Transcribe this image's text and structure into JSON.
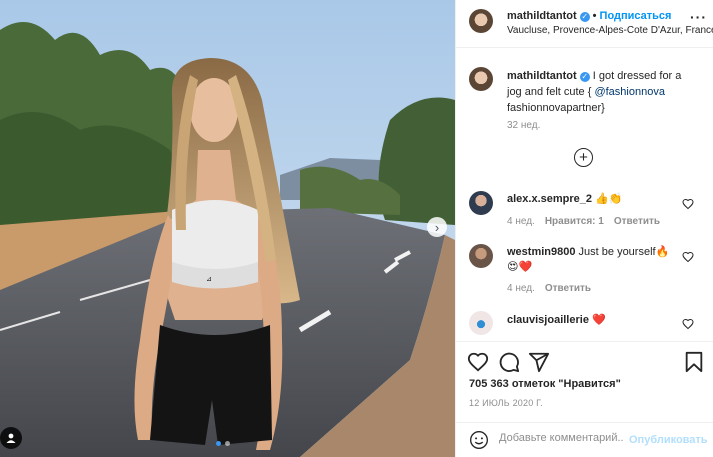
{
  "post": {
    "author": "mathildtantot",
    "follow_label": "Подписаться",
    "separator": "•",
    "location": "Vaucluse, Provence-Alpes-Cote D'Azur, France",
    "more_label": "···"
  },
  "caption": {
    "author": "mathildtantot",
    "text_before": "I got dressed for a jog and felt cute { ",
    "mention": "@fashionnova",
    "text_after": " fashionnovapartner}",
    "time": "32 нед."
  },
  "comments": [
    {
      "user": "alex.x.sempre_2",
      "text": "👍👏",
      "time": "4 нед.",
      "likes": "Нравится: 1",
      "reply": "Ответить"
    },
    {
      "user": "westmin9800",
      "text": "Just be yourself🔥😍❤️",
      "time": "4 нед.",
      "likes": "",
      "reply": "Ответить"
    },
    {
      "user": "clauvisjoaillerie",
      "text": "❤️",
      "time": "",
      "likes": "",
      "reply": ""
    }
  ],
  "stats": {
    "likes": "705 363 отметок \"Нравится\"",
    "date": "12 ИЮЛЬ 2020 Г."
  },
  "comment_box": {
    "placeholder": "Добавьте комментарий...",
    "post_label": "Опубликовать"
  },
  "icons": {
    "verified": "verified-badge-icon",
    "more": "more-options-icon",
    "load_more": "plus-circle-icon",
    "heart": "heart-icon",
    "comment": "comment-icon",
    "share": "share-icon",
    "save": "bookmark-icon",
    "emoji": "emoji-icon",
    "next": "chevron-right-icon",
    "tag": "user-tag-icon"
  },
  "colors": {
    "accent": "#0095f6",
    "verified": "#3897f0",
    "post_disabled": "#b2dffc",
    "text": "#262626",
    "muted": "#8e8e8e"
  },
  "carousel": {
    "slide": 1,
    "total": 2
  }
}
